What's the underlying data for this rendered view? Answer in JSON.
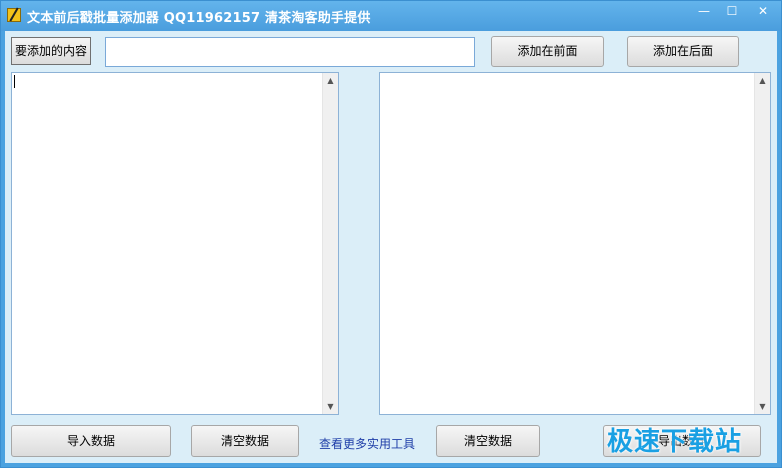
{
  "window": {
    "title": "文本前后戳批量添加器 QQ11962157 清茶淘客助手提供",
    "minimize_glyph": "—",
    "maximize_glyph": "☐",
    "close_glyph": "✕"
  },
  "toolbar": {
    "content_label": "要添加的内容",
    "content_value": "",
    "add_front_label": "添加在前面",
    "add_back_label": "添加在后面"
  },
  "left_panel": {
    "text": "",
    "scroll_up_glyph": "▲",
    "scroll_down_glyph": "▼"
  },
  "right_panel": {
    "text": "",
    "scroll_up_glyph": "▲",
    "scroll_down_glyph": "▼"
  },
  "bottom": {
    "import_label": "导入数据",
    "clear_left_label": "清空数据",
    "more_tools_link": "查看更多实用工具",
    "clear_right_label": "清空数据",
    "export_label": "导出数据"
  },
  "watermark": {
    "text": "极速下载站"
  }
}
